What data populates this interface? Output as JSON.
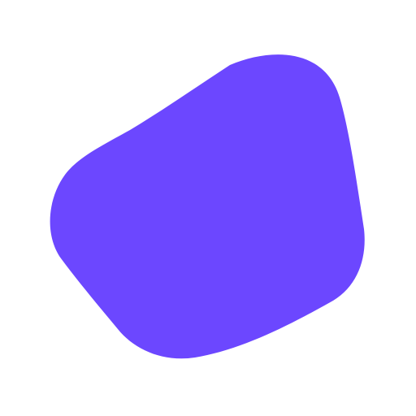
{
  "canvas": {
    "background_color": "#ffffff"
  },
  "blob": {
    "shape_name": "blob-shape",
    "fill_color": "#6c47ff"
  }
}
